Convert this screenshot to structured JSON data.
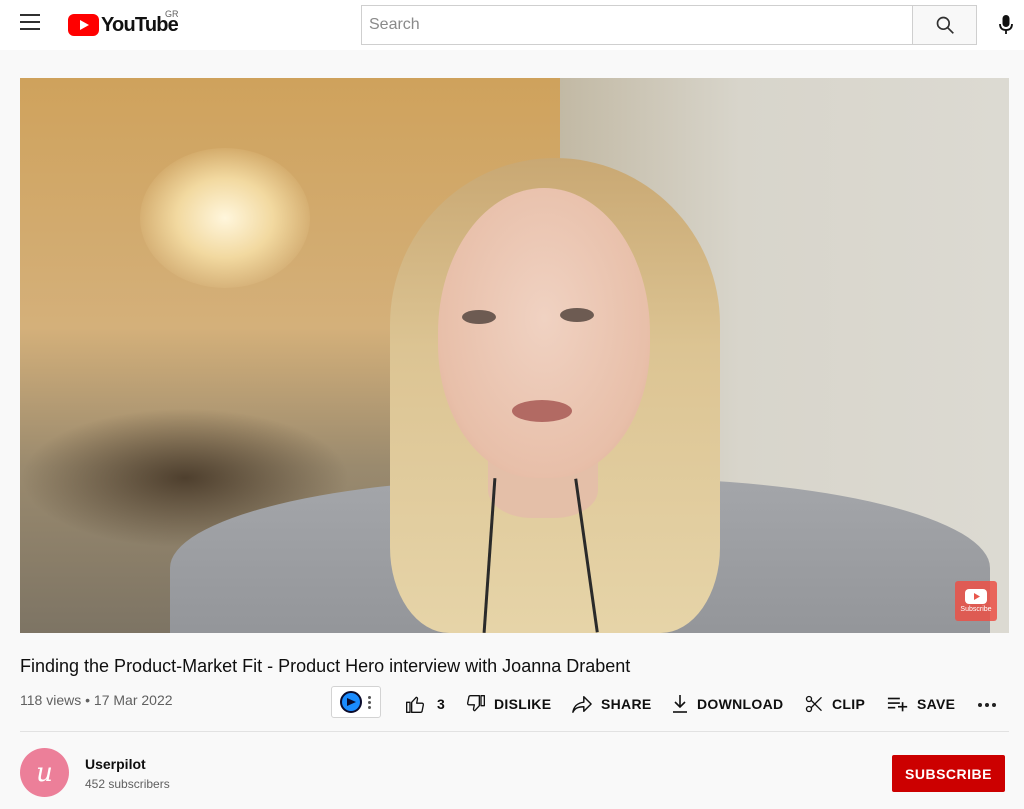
{
  "header": {
    "logo_text": "YouTube",
    "country_code": "GR",
    "search_placeholder": "Search",
    "icons": [
      "menu-icon",
      "youtube-logo-icon",
      "search-icon",
      "mic-icon"
    ]
  },
  "player": {
    "watermark_label": "Subscribe"
  },
  "video": {
    "title": "Finding the Product-Market Fit - Product Hero interview with Joanna Drabent",
    "views": "118 views",
    "separator": "•",
    "date": "17 Mar 2022"
  },
  "actions": {
    "like_count": "3",
    "dislike_label": "DISLIKE",
    "share_label": "SHARE",
    "download_label": "DOWNLOAD",
    "clip_label": "CLIP",
    "save_label": "SAVE"
  },
  "channel": {
    "avatar_letter": "u",
    "name": "Userpilot",
    "subscribers": "452 subscribers",
    "subscribe_label": "SUBSCRIBE",
    "avatar_color": "#ec7f99"
  },
  "colors": {
    "brand_red": "#ff0000",
    "subscribe_red": "#cc0000",
    "text_primary": "#0f0f0f",
    "text_secondary": "#606060"
  }
}
